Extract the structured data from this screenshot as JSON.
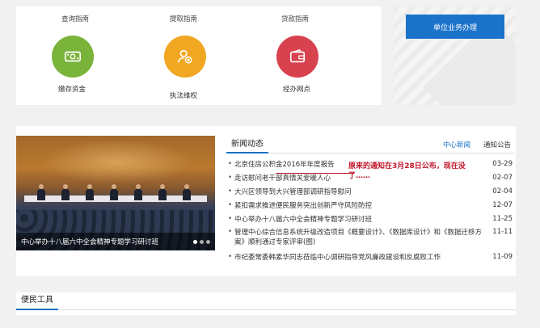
{
  "guides": {
    "query": "查询指南",
    "withdraw": "提取指南",
    "loan": "贷款指南"
  },
  "services": [
    {
      "label": "缴存资金",
      "icon": "money-icon",
      "color": "#7ab33a"
    },
    {
      "label": "执法维权",
      "icon": "user-shield-icon",
      "color": "#f2a723"
    },
    {
      "label": "经办网点",
      "icon": "wallet-icon",
      "color": "#d8424f"
    }
  ],
  "side": {
    "button": "单位业务办理"
  },
  "news": {
    "title": "新闻动态",
    "tabs": [
      "中心新闻",
      "通知公告"
    ],
    "photo_caption": "中心举办十八届六中全会精神专题学习研讨班",
    "items": [
      {
        "text": "北京住房公积金2016年年度报告",
        "date": "03-29"
      },
      {
        "text": "走访慰问老干部真情关爱暖人心",
        "date": "02-07"
      },
      {
        "text": "大兴区领导到大兴管理部调研指导慰问",
        "date": "02-04"
      },
      {
        "text": "紧扣需求推进便民服务突出创新严守风险防控",
        "date": "12-07"
      },
      {
        "text": "中心举办十八届六中全会精神专题学习研讨班",
        "date": "11-25"
      },
      {
        "text": "管理中心综合信息系统升级改造项目《概要设计》、《数据库设计》和《数据迁移方案》顺利通过专家评审(图)",
        "date": "11-11"
      },
      {
        "text": "市纪委常委韩素华同志莅临中心调研指导党风廉政建设和反腐败工作",
        "date": "11-09"
      }
    ]
  },
  "annotation": "原来的通知在3月28日公布，现在没了……",
  "tools": {
    "title": "便民工具"
  },
  "colors": {
    "accent": "#1a73c9",
    "annotation": "#c0152a"
  }
}
